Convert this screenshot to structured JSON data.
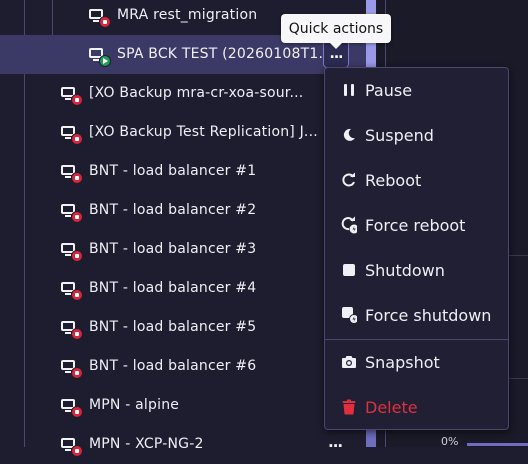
{
  "tree": {
    "rows": [
      {
        "label": "MRA rest_migration",
        "status": "halted"
      },
      {
        "label": "SPA BCK TEST (20260108T1...",
        "status": "running",
        "selected": true
      },
      {
        "label": "[XO Backup mra-cr-xoa-sour...",
        "status": "halted"
      },
      {
        "label": "[XO Backup Test Replication] J...",
        "status": "halted"
      },
      {
        "label": "BNT - load balancer #1",
        "status": "halted"
      },
      {
        "label": "BNT - load balancer #2",
        "status": "halted"
      },
      {
        "label": "BNT - load balancer #3",
        "status": "halted"
      },
      {
        "label": "BNT - load balancer #4",
        "status": "halted"
      },
      {
        "label": "BNT - load balancer #5",
        "status": "halted"
      },
      {
        "label": "BNT - load balancer #6",
        "status": "halted"
      },
      {
        "label": "MPN - alpine",
        "status": "halted"
      },
      {
        "label": "MPN - XCP-NG-2",
        "status": "halted"
      }
    ],
    "more_label": "..."
  },
  "tooltip": {
    "text": "Quick actions"
  },
  "menu": {
    "items": [
      {
        "label": "Pause",
        "icon": "pause-icon"
      },
      {
        "label": "Suspend",
        "icon": "moon-icon"
      },
      {
        "label": "Reboot",
        "icon": "rotate-icon"
      },
      {
        "label": "Force reboot",
        "icon": "force-rotate-icon"
      },
      {
        "label": "Shutdown",
        "icon": "stop-icon"
      },
      {
        "label": "Force shutdown",
        "icon": "force-stop-icon"
      },
      {
        "label": "Snapshot",
        "icon": "camera-icon"
      },
      {
        "label": "Delete",
        "icon": "trash-icon",
        "danger": true
      }
    ]
  },
  "right_pane": {
    "percent": "0%"
  },
  "colors": {
    "danger": "#e0303f",
    "running": "#1f9c58",
    "halted": "#d9253a",
    "selection": "#3b3a66",
    "accent": "#9a98e8"
  }
}
